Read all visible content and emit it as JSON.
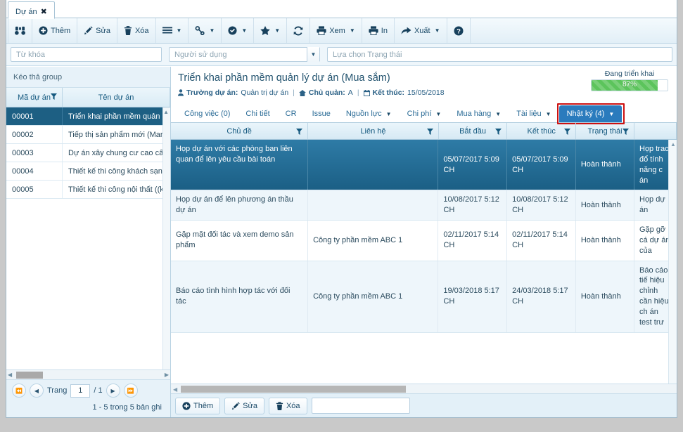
{
  "window": {
    "document_tab": {
      "label": "Dự án",
      "close_icon": "close-icon"
    }
  },
  "toolbar": {
    "buttons": [
      {
        "icon": "binoculars-icon",
        "label": "",
        "caret": false
      },
      {
        "icon": "plus-circle-icon",
        "label": "Thêm",
        "caret": false
      },
      {
        "icon": "pencil-icon",
        "label": "Sửa",
        "caret": false
      },
      {
        "icon": "trash-icon",
        "label": "Xóa",
        "caret": false
      },
      {
        "icon": "list-icon",
        "label": "",
        "caret": true
      },
      {
        "icon": "link-icon",
        "label": "",
        "caret": true
      },
      {
        "icon": "check-circle-icon",
        "label": "",
        "caret": true
      },
      {
        "icon": "star-icon",
        "label": "",
        "caret": true
      },
      {
        "icon": "refresh-icon",
        "label": "",
        "caret": false
      },
      {
        "icon": "printer-icon",
        "label": "Xem",
        "caret": true
      },
      {
        "icon": "print-icon",
        "label": "In",
        "caret": false
      },
      {
        "icon": "export-icon",
        "label": "Xuất",
        "caret": true
      },
      {
        "icon": "help-icon",
        "label": "",
        "caret": false
      }
    ]
  },
  "filters": {
    "keyword_placeholder": "Từ khóa",
    "keyword_value": "",
    "user_placeholder": "Người sử dụng",
    "user_value": "",
    "status_placeholder": "Lựa chọn Trạng thái",
    "status_value": ""
  },
  "project_grid": {
    "group_bar_text": "Kéo thả group",
    "columns": [
      "Mã dự án",
      "Tên dự án"
    ],
    "rows": [
      {
        "code": "00001",
        "name": "Triển khai phần mềm quản lý dự án (",
        "selected": true
      },
      {
        "code": "00002",
        "name": "Tiếp thị sản phẩm mới (Marketing)",
        "selected": false
      },
      {
        "code": "00003",
        "name": "Dự án xây chung cư cao cấp A (Xây ",
        "selected": false
      },
      {
        "code": "00004",
        "name": "Thiết kế thi công khách sạn B (Xây lắ",
        "selected": false
      },
      {
        "code": "00005",
        "name": "Thiết kế thi công nội thất ((kiến trúc)",
        "selected": false
      }
    ],
    "pager": {
      "label": "Trang",
      "current_page": "1",
      "total_pages": "/ 1",
      "summary": "1 - 5 trong 5 bản ghi",
      "first_icon": "first-page-icon",
      "prev_icon": "prev-page-icon",
      "next_icon": "next-page-icon",
      "last_icon": "last-page-icon"
    }
  },
  "detail": {
    "title": "Triển khai phần mềm quản lý dự án (Mua sắm)",
    "meta": {
      "manager_label": "Trưởng dự án:",
      "manager_value": "Quản trị dự án",
      "owner_label": "Chủ quản:",
      "owner_value": "A",
      "end_label": "Kết thúc:",
      "end_value": "15/05/2018"
    },
    "progress": {
      "label": "Đang triển khai",
      "percent_text": "87%",
      "percent": 87,
      "color": "#5cc45c"
    },
    "tabs": [
      {
        "label": "Công việc (0)",
        "caret": false,
        "active": false
      },
      {
        "label": "Chi tiết",
        "caret": false,
        "active": false
      },
      {
        "label": "CR",
        "caret": false,
        "active": false
      },
      {
        "label": "Issue",
        "caret": false,
        "active": false
      },
      {
        "label": "Nguồn lực",
        "caret": true,
        "active": false
      },
      {
        "label": "Chi phí",
        "caret": true,
        "active": false
      },
      {
        "label": "Mua hàng",
        "caret": true,
        "active": false
      },
      {
        "label": "Tài liệu",
        "caret": true,
        "active": false
      },
      {
        "label": "Nhật ký (4)",
        "caret": true,
        "active": true
      }
    ],
    "highlight_color": "#cc1111",
    "log_grid": {
      "columns": [
        "Chủ đề",
        "Liên hệ",
        "Bắt đầu",
        "Kết thúc",
        "Trạng thái",
        ""
      ],
      "rows": [
        {
          "subject": "Họp dự án với các phòng ban liên quan để lên yêu cầu bài toán",
          "contact": "",
          "start": "05/07/2017 5:09 CH",
          "end": "05/07/2017 5:09 CH",
          "status": "Hoàn thành",
          "note": "Họp trao đổ tính năng c án",
          "selected": true
        },
        {
          "subject": "Họp dự án để lên phương án thầu dự án",
          "contact": "",
          "start": "10/08/2017 5:12 CH",
          "end": "10/08/2017 5:12 CH",
          "status": "Hoàn thành",
          "note": "Họp dự án",
          "selected": false
        },
        {
          "subject": "Gặp mặt đối tác và xem demo sản phẩm",
          "contact": "Công ty phần mềm ABC 1",
          "start": "02/11/2017 5:14 CH",
          "end": "02/11/2017 5:14 CH",
          "status": "Hoàn thành",
          "note": "Gặp gỡ cá dự án của",
          "selected": false
        },
        {
          "subject": "Báo cáo tình hình hợp tác với đối tác",
          "contact": "Công ty phần mềm ABC 1",
          "start": "19/03/2018 5:17 CH",
          "end": "24/03/2018 5:17 CH",
          "status": "Hoàn thành",
          "note": "Báo cáo tiế hiệu chỉnh cần hiệu ch án test trư",
          "selected": false
        }
      ]
    },
    "bottom_toolbar": {
      "add_label": "Thêm",
      "edit_label": "Sửa",
      "delete_label": "Xóa",
      "input_value": ""
    }
  }
}
